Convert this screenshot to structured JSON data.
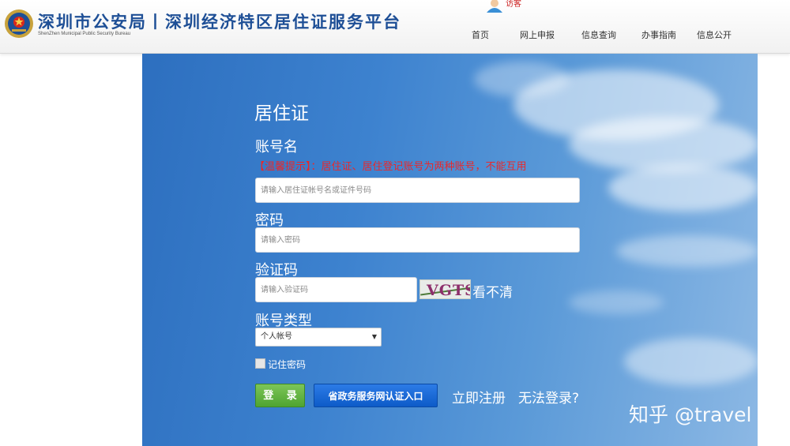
{
  "header": {
    "title_cn": "深圳市公安局丨深圳经济特区居住证服务平台",
    "title_en": "ShenZhen Municipal Public Security Bureau",
    "visitor_label": "访客",
    "nav": [
      "首页",
      "网上申报",
      "信息查询",
      "办事指南",
      "信息公开"
    ]
  },
  "form": {
    "title": "居住证",
    "account_label": "账号名",
    "tip": "【温馨提示】：居住证、居住登记账号为两种账号，不能互用",
    "account_placeholder": "请输入居住证帐号名或证件号码",
    "password_label": "密码",
    "password_placeholder": "请输入密码",
    "captcha_label": "验证码",
    "captcha_placeholder": "请输入验证码",
    "captcha_text": "VGTS",
    "refresh_label": "看不清",
    "account_type_label": "账号类型",
    "account_type_selected": "个人帐号",
    "remember_label": "记住密码",
    "login_button": "登 录",
    "gov_button": "省政务服务网认证入口",
    "register_link": "立即注册",
    "cannot_login_link": "无法登录?"
  },
  "watermark": "知乎 @travel",
  "colors": {
    "brand_blue": "#1e4f96",
    "tip_red": "#e8282b",
    "login_green": "#4fa431",
    "gov_blue": "#0d5bc8"
  }
}
